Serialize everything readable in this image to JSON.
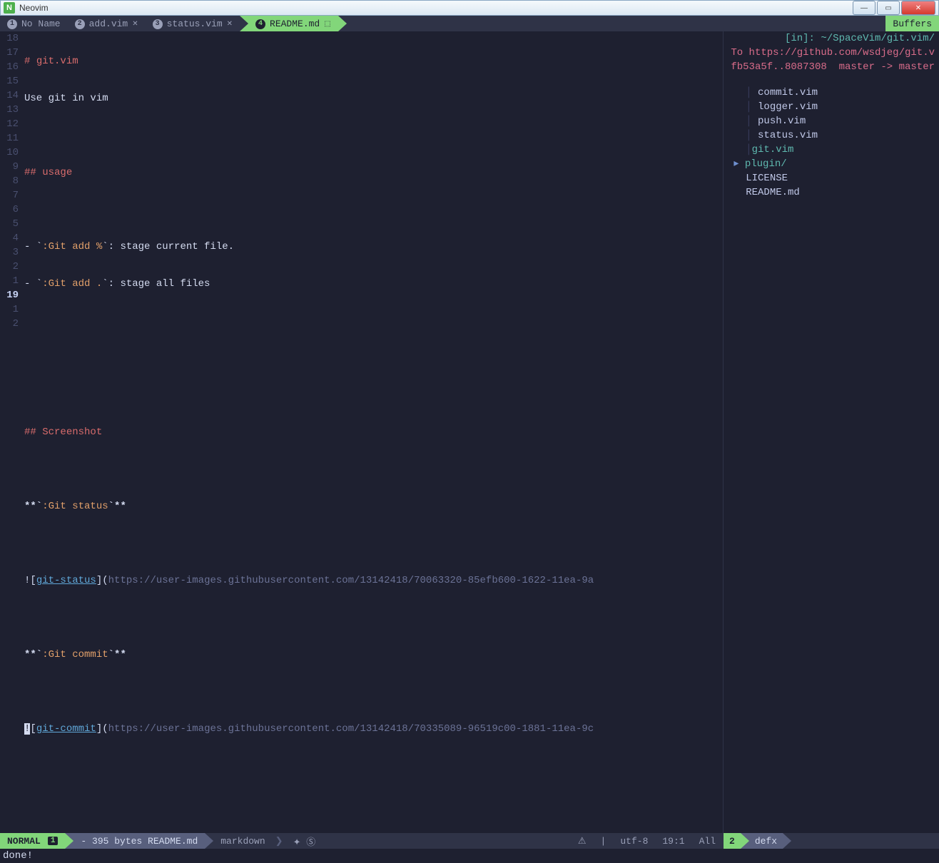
{
  "window": {
    "title": "Neovim",
    "app_icon_letter": "N"
  },
  "tabs": [
    {
      "num": "1",
      "label": "No Name",
      "modified": false,
      "active": false
    },
    {
      "num": "2",
      "label": "add.vim",
      "modified": true,
      "active": false
    },
    {
      "num": "3",
      "label": "status.vim",
      "modified": true,
      "active": false
    },
    {
      "num": "4",
      "label": "README.md",
      "modified": true,
      "active": true,
      "mod_glyph": "⬚"
    }
  ],
  "buffers_label": "Buffers",
  "gutter": [
    "18",
    "17",
    "16",
    "15",
    "14",
    "13",
    "12",
    "11",
    "10",
    "9",
    "8",
    "7",
    "6",
    "5",
    "4",
    "3",
    "2",
    "1",
    "19",
    "1",
    "2"
  ],
  "gutter_current_index": 18,
  "code": {
    "l0": {
      "hash": "# ",
      "title": "git.vim"
    },
    "l1": "Use git in vim",
    "empty": "",
    "l3": {
      "hash": "## ",
      "title": "usage"
    },
    "l5": {
      "bullet": "- `",
      "cmd": ":Git add %",
      "rest": "`: stage current file."
    },
    "l6": {
      "bullet": "- `",
      "cmd": ":Git add .",
      "rest": "`: stage all files"
    },
    "l10": {
      "hash": "## ",
      "title": "Screenshot"
    },
    "l12": {
      "open": "**`",
      "cmd": ":Git status",
      "close": "`**"
    },
    "l14": {
      "bang": "!",
      "lb": "[",
      "text": "git-status",
      "rb": "]",
      "lp": "(",
      "url": "https://user-images.githubusercontent.com/13142418/70063320-85efb600-1622-11ea-9a"
    },
    "l16": {
      "open": "**`",
      "cmd": ":Git commit",
      "close": "`**"
    },
    "l18": {
      "bang": "!",
      "lb": "[",
      "text": "git-commit",
      "rb": "]",
      "lp": "(",
      "url": "https://user-images.githubusercontent.com/13142418/70335089-96519c00-1881-11ea-9c"
    }
  },
  "messages": {
    "m1": "[in]: ~/SpaceVim/git.vim/",
    "m2": "To https://github.com/wsdjeg/git.v",
    "m3_left": "fb53a5f..8087308",
    "m3_right": "master -> master"
  },
  "tree": [
    {
      "indent": "   │ ",
      "name": "commit.vim",
      "type": "file"
    },
    {
      "indent": "   │ ",
      "name": "logger.vim",
      "type": "file"
    },
    {
      "indent": "   │ ",
      "name": "push.vim",
      "type": "file"
    },
    {
      "indent": "   │ ",
      "name": "status.vim",
      "type": "file"
    },
    {
      "indent": "   │",
      "name": "git.vim",
      "type": "file-teal"
    },
    {
      "indent": " ▸ ",
      "name": "plugin/",
      "type": "dir"
    },
    {
      "indent": "   ",
      "name": "LICENSE",
      "type": "file"
    },
    {
      "indent": "   ",
      "name": "README.md",
      "type": "file"
    }
  ],
  "statusline": {
    "mode": "NORMAL",
    "winnr": "1",
    "file": "- 395 bytes README.md",
    "filetype": "markdown",
    "icons": "✦ Ⓢ",
    "warn": "⚠",
    "sep": "|",
    "enc": "utf-8",
    "pos": "19:1",
    "pct": "All",
    "right_winnr": "2",
    "right_name": "defx"
  },
  "cmdline": "done!"
}
